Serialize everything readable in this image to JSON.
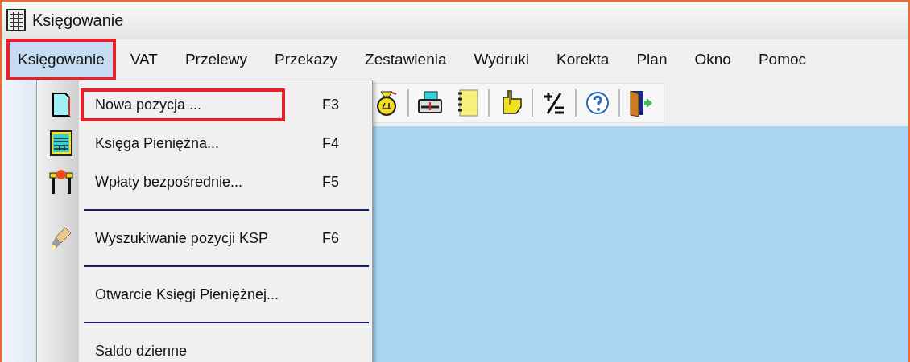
{
  "window": {
    "title": "Księgowanie"
  },
  "menu_bar": [
    {
      "label": "Księgowanie",
      "selected": true
    },
    {
      "label": "VAT",
      "selected": false
    },
    {
      "label": "Przelewy",
      "selected": false
    },
    {
      "label": "Przekazy",
      "selected": false
    },
    {
      "label": "Zestawienia",
      "selected": false
    },
    {
      "label": "Wydruki",
      "selected": false
    },
    {
      "label": "Korekta",
      "selected": false
    },
    {
      "label": "Plan",
      "selected": false
    },
    {
      "label": "Okno",
      "selected": false
    },
    {
      "label": "Pomoc",
      "selected": false
    }
  ],
  "dropdown": [
    {
      "kind": "item",
      "label": "Nowa pozycja ...",
      "shortcut": "F3",
      "highlighted": true
    },
    {
      "kind": "item",
      "label": "Księga Pieniężna...",
      "shortcut": "F4",
      "highlighted": false
    },
    {
      "kind": "item",
      "label": "Wpłaty bezpośrednie...",
      "shortcut": "F5",
      "highlighted": false
    },
    {
      "kind": "separator"
    },
    {
      "kind": "item",
      "label": "Wyszukiwanie pozycji KSP",
      "shortcut": "F6",
      "highlighted": false
    },
    {
      "kind": "separator"
    },
    {
      "kind": "item",
      "label": "Otwarcie Księgi Pieniężnej...",
      "highlighted": false
    },
    {
      "kind": "separator"
    },
    {
      "kind": "item",
      "label": "Saldo dzienne",
      "highlighted": false
    }
  ],
  "toolbar": [
    {
      "kind": "button"
    },
    {
      "kind": "separator"
    },
    {
      "kind": "button"
    },
    {
      "kind": "button"
    },
    {
      "kind": "separator"
    },
    {
      "kind": "button"
    },
    {
      "kind": "separator"
    },
    {
      "kind": "button"
    },
    {
      "kind": "separator"
    },
    {
      "kind": "button"
    },
    {
      "kind": "separator"
    },
    {
      "kind": "button"
    }
  ]
}
